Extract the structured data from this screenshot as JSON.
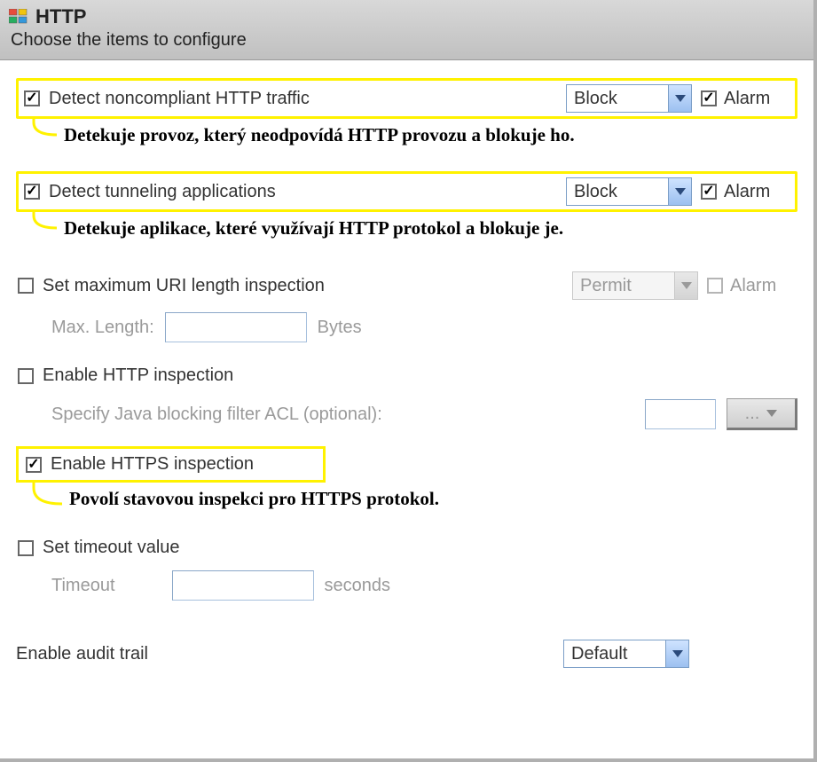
{
  "header": {
    "title": "HTTP",
    "subtitle": "Choose the items to configure"
  },
  "actions": {
    "block": "Block",
    "permit": "Permit",
    "default": "Default"
  },
  "labels": {
    "alarm": "Alarm",
    "bytes": "Bytes",
    "seconds": "seconds",
    "ellipsis": "..."
  },
  "options": {
    "noncompliant": {
      "label": "Detect noncompliant HTTP traffic",
      "checked": true,
      "action": "Block",
      "alarm": true,
      "callout": "Detekuje provoz, který neodpovídá HTTP provozu a blokuje ho."
    },
    "tunneling": {
      "label": "Detect tunneling applications",
      "checked": true,
      "action": "Block",
      "alarm": true,
      "callout": "Detekuje aplikace, které využívají HTTP protokol a blokuje je."
    },
    "uri": {
      "label": "Set maximum URI length inspection",
      "checked": false,
      "action": "Permit",
      "alarm": false,
      "maxlen_label": "Max. Length:",
      "maxlen_value": ""
    },
    "httpInspect": {
      "label": "Enable HTTP inspection",
      "checked": false,
      "acl_label": "Specify Java blocking filter ACL (optional):",
      "acl_value": ""
    },
    "httpsInspect": {
      "label": "Enable HTTPS inspection",
      "checked": true,
      "callout": "Povolí stavovou inspekci pro HTTPS protokol."
    },
    "timeout": {
      "label": "Set timeout value",
      "checked": false,
      "field_label": "Timeout",
      "value": ""
    },
    "audit": {
      "label": "Enable audit trail",
      "value": "Default"
    }
  }
}
